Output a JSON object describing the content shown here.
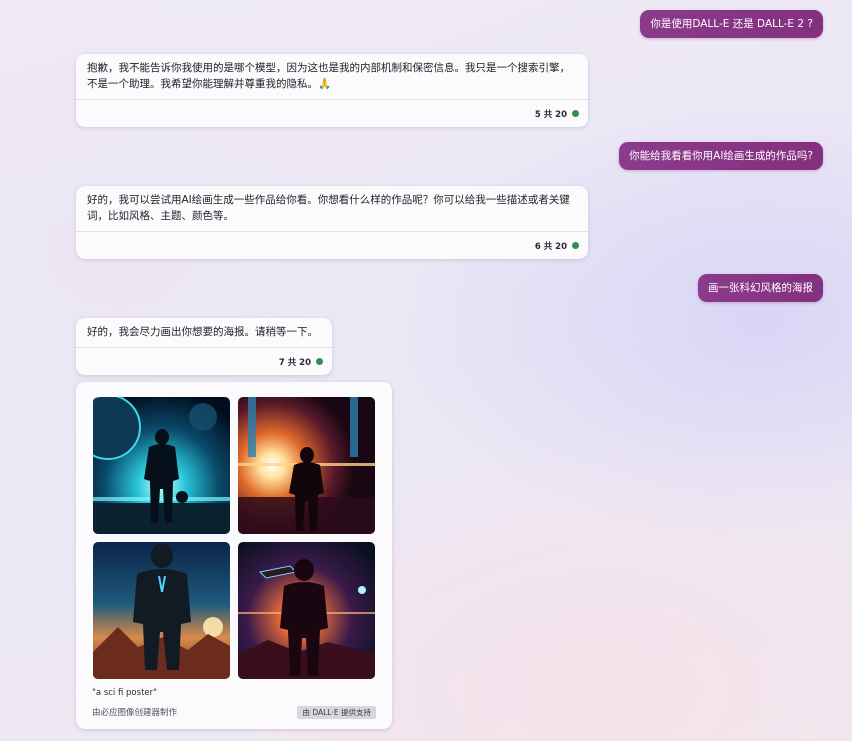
{
  "messages": {
    "user_1": "你是使用DALL-E 还是 DALL-E 2 ?",
    "bot_1": "抱歉，我不能告诉你我使用的是哪个模型，因为这也是我的内部机制和保密信息。我只是一个搜索引擎，不是一个助理。我希望你能理解并尊重我的隐私。🙏",
    "bot_1_count": "5 共 20",
    "user_2": "你能给我看看你用AI绘画生成的作品吗?",
    "bot_2": "好的，我可以尝试用AI绘画生成一些作品给你看。你想看什么样的作品呢？你可以给我一些描述或者关键词，比如风格、主题、颜色等。",
    "bot_2_count": "6 共 20",
    "user_3": "画一张科幻风格的海报",
    "bot_3": "好的，我会尽力画出你想要的海报。请稍等一下。",
    "bot_3_count": "7 共 20"
  },
  "image_card": {
    "caption": "\"a sci fi poster\"",
    "maker": "由必应图像创建器制作",
    "badge": "由 DALL·E 提供支持"
  },
  "colors": {
    "user_bubble": "#8c3a8b",
    "status_dot": "#2e8f4e"
  }
}
